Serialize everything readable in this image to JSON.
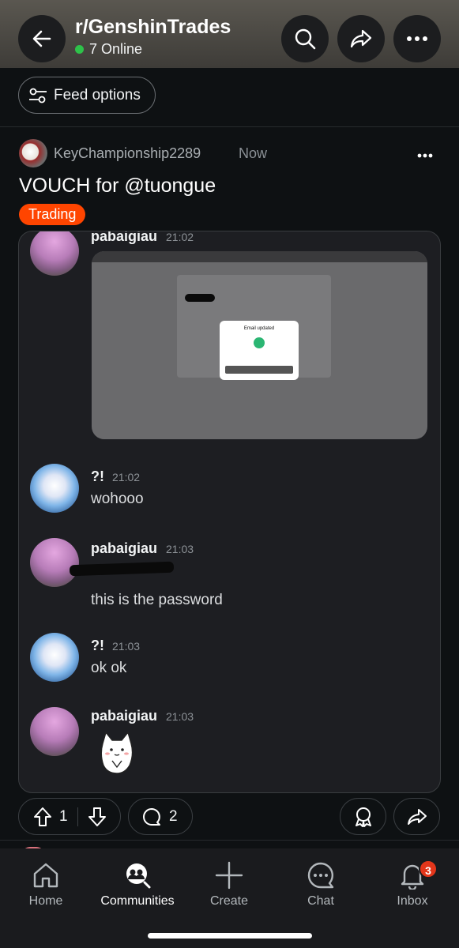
{
  "header": {
    "subreddit": "r/GenshinTrades",
    "online_count": "7 Online",
    "icons": [
      "back-arrow-icon",
      "search-icon",
      "share-icon",
      "more-icon"
    ]
  },
  "feed_options": {
    "label": "Feed options"
  },
  "post": {
    "author": "KeyChampionship2289",
    "time": "Now",
    "title": "VOUCH for @tuongue",
    "flair": "Trading",
    "upvotes": "1",
    "comments": "2"
  },
  "chat": {
    "messages": [
      {
        "name": "pabaigiau",
        "time": "21:02",
        "text": ""
      },
      {
        "name": "?!",
        "time": "21:02",
        "text": "wohooo"
      },
      {
        "name": "pabaigiau",
        "time": "21:03",
        "text": "this is the password"
      },
      {
        "name": "?!",
        "time": "21:03",
        "text": "ok ok"
      },
      {
        "name": "pabaigiau",
        "time": "21:03",
        "text": ""
      }
    ],
    "embedded_dialog_title": "Email updated"
  },
  "bottom_nav": {
    "items": [
      {
        "label": "Home",
        "icon": "home-icon"
      },
      {
        "label": "Communities",
        "icon": "communities-icon"
      },
      {
        "label": "Create",
        "icon": "plus-icon"
      },
      {
        "label": "Chat",
        "icon": "chat-icon"
      },
      {
        "label": "Inbox",
        "icon": "bell-icon"
      }
    ],
    "inbox_badge": "3"
  },
  "colors": {
    "background": "#0e1113",
    "flair": "#ff4500",
    "online_dot": "#2ec24a",
    "badge": "#e3361b"
  }
}
